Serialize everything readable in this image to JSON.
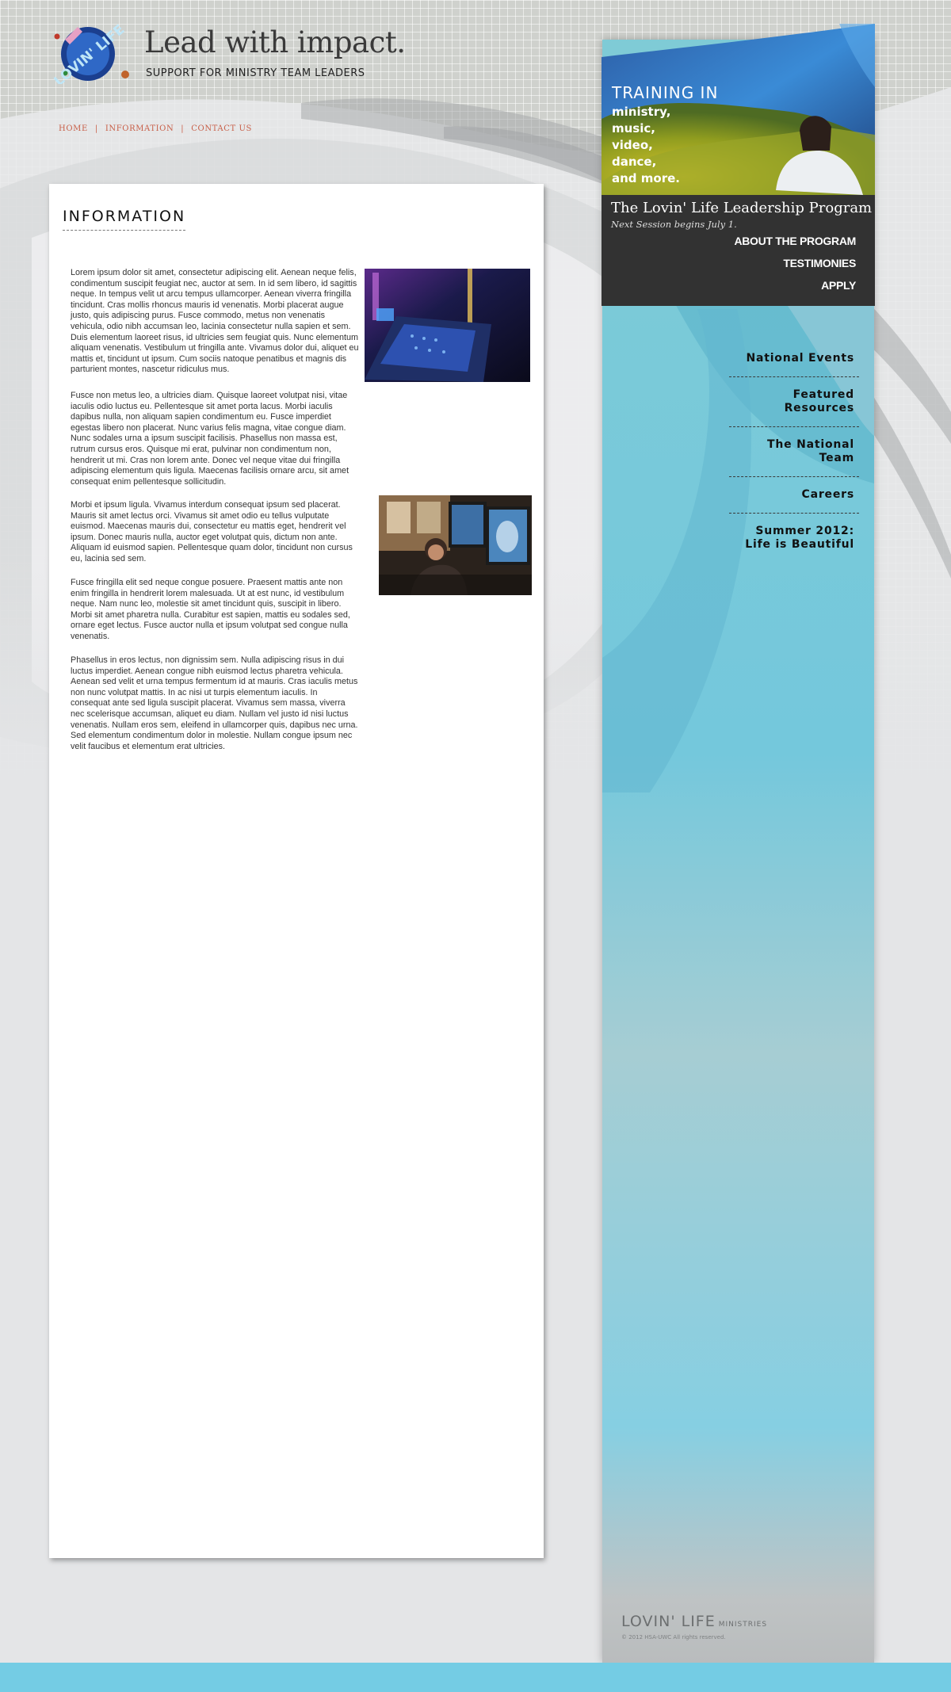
{
  "header": {
    "logo_text": "LOVIN' LIFE",
    "tagline": "Lead with impact.",
    "subtagline": "SUPPORT FOR MINISTRY TEAM LEADERS"
  },
  "topnav": {
    "items": [
      {
        "label": "HOME"
      },
      {
        "label": "INFORMATION"
      },
      {
        "label": "CONTACT US"
      }
    ],
    "separator": "|"
  },
  "main": {
    "title": "INFORMATION",
    "paragraphs": [
      "Lorem ipsum dolor sit amet, consectetur adipiscing elit. Aenean neque felis, condimentum suscipit feugiat nec, auctor at sem. In id sem libero, id sagittis neque. In tempus velit ut arcu tempus ullamcorper. Aenean viverra fringilla tincidunt. Cras mollis rhoncus mauris id venenatis. Morbi placerat augue justo, quis adipiscing purus. Fusce commodo, metus non venenatis vehicula, odio nibh accumsan leo, lacinia consectetur nulla sapien et sem. Duis elementum laoreet risus, id ultricies sem feugiat quis. Nunc elementum aliquam venenatis. Vestibulum ut fringilla ante. Vivamus dolor dui, aliquet eu mattis et, tincidunt ut ipsum. Cum sociis natoque penatibus et magnis dis parturient montes, nascetur ridiculus mus.",
      "Fusce non metus leo, a ultricies diam. Quisque laoreet volutpat nisi, vitae iaculis odio luctus eu. Pellentesque sit amet porta lacus. Morbi iaculis dapibus nulla, non aliquam sapien condimentum eu. Fusce imperdiet egestas libero non placerat. Nunc varius felis magna, vitae congue diam. Nunc sodales urna a ipsum suscipit facilisis. Phasellus non massa est, rutrum cursus eros. Quisque mi erat, pulvinar non condimentum non, hendrerit ut mi. Cras non lorem ante. Donec vel neque vitae dui fringilla adipiscing elementum quis ligula. Maecenas facilisis ornare arcu, sit amet consequat enim pellentesque sollicitudin.",
      "Morbi et ipsum ligula. Vivamus interdum consequat ipsum sed placerat. Mauris sit amet lectus orci. Vivamus sit amet odio eu tellus vulputate euismod. Maecenas mauris dui, consectetur eu mattis eget, hendrerit vel ipsum. Donec mauris nulla, auctor eget volutpat quis, dictum non ante. Aliquam id euismod sapien. Pellentesque quam dolor, tincidunt non cursus eu, lacinia sed sem.",
      "Fusce fringilla elit sed neque congue posuere. Praesent mattis ante non enim fringilla in hendrerit lorem malesuada. Ut at est nunc, id vestibulum neque. Nam nunc leo, molestie sit amet tincidunt quis, suscipit in libero. Morbi sit amet pharetra nulla. Curabitur est sapien, mattis eu sodales sed, ornare eget lectus. Fusce auctor nulla et ipsum volutpat sed congue nulla venenatis.",
      "Phasellus in eros lectus, non dignissim sem. Nulla adipiscing risus in dui luctus imperdiet. Aenean congue nibh euismod lectus pharetra vehicula. Aenean sed velit et urna tempus fermentum id at mauris. Cras iaculis metus non nunc volutpat mattis. In ac nisi ut turpis elementum iaculis. In consequat ante sed ligula suscipit placerat. Vivamus sem massa, viverra nec scelerisque accumsan, aliquet eu diam. Nullam vel justo id nisi luctus venenatis. Nullam eros sem, eleifend in ullamcorper quis, dapibus nec urna. Sed elementum condimentum dolor in molestie. Nullam congue ipsum nec velit faucibus et elementum erat ultricies."
    ]
  },
  "promo": {
    "heading": "TRAINING IN",
    "lines": [
      "ministry,",
      "music,",
      "video,",
      "dance,",
      "and more."
    ],
    "program_title": "The Lovin' Life Leadership Program",
    "program_subtitle": "Next Session begins July 1.",
    "links": [
      {
        "label": "ABOUT THE PROGRAM"
      },
      {
        "label": "TESTIMONIES"
      },
      {
        "label": "APPLY"
      }
    ]
  },
  "sidenav": {
    "items": [
      {
        "label": "National Events"
      },
      {
        "label": "Featured Resources"
      },
      {
        "label": "The National Team"
      },
      {
        "label": "Careers"
      },
      {
        "label_line1": "Summer 2012:",
        "label_line2": "Life is Beautiful"
      }
    ]
  },
  "footer": {
    "brand": "LOVIN' LIFE",
    "brand_suffix": "MINISTRIES",
    "copyright": "© 2012 HSA-UWC All rights reserved."
  },
  "colors": {
    "nav_link": "#c85f48",
    "promo_box": "#323232",
    "sidebar_blue": "#74c8dc",
    "bottom_bar": "#74cce4"
  }
}
